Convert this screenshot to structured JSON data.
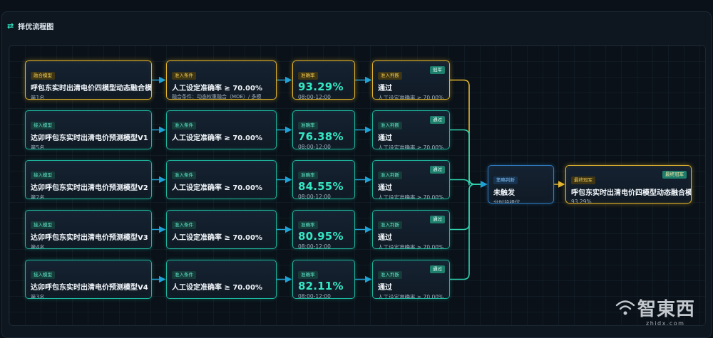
{
  "panel": {
    "title": "择优流程图",
    "icon": "flow-icon"
  },
  "colors": {
    "accent": "#1fb69d",
    "gold": "#e3b52e",
    "blue": "#2f7ec4",
    "link": "#1fa1d6"
  },
  "rows": [
    {
      "model": {
        "tag": "融合模型",
        "name": "呼包东实时出清电价四模型动态融合模型",
        "rank": "第1名",
        "style": "gold"
      },
      "condition": {
        "tag": "准入条件",
        "text": "人工设定准确率 ≥ 70.00%",
        "note": "融合条件：动态权重融合（MOE）/ 多模型... 权融合",
        "style": "gold"
      },
      "accuracy": {
        "tag": "准确率",
        "value": "93.29%",
        "time": "08:00-12:00",
        "style": "gold"
      },
      "judge": {
        "tag": "准入判断",
        "badge": "冠军",
        "result": "通过",
        "detail": "人工设定准确率 ≥ 70.00%",
        "style": "gold"
      }
    },
    {
      "model": {
        "tag": "接入模型",
        "name": "达卯呼包东实时出清电价预测模型V1",
        "rank": "第5名",
        "style": ""
      },
      "condition": {
        "tag": "准入条件",
        "text": "人工设定准确率 ≥ 70.00%",
        "note": "",
        "style": ""
      },
      "accuracy": {
        "tag": "准确率",
        "value": "76.38%",
        "time": "08:00-12:00",
        "style": ""
      },
      "judge": {
        "tag": "准入判断",
        "badge": "通过",
        "result": "通过",
        "detail": "人工设定准确率 ≥ 70.00%",
        "style": ""
      }
    },
    {
      "model": {
        "tag": "接入模型",
        "name": "达卯呼包东实时出清电价预测模型V2",
        "rank": "第2名",
        "style": ""
      },
      "condition": {
        "tag": "准入条件",
        "text": "人工设定准确率 ≥ 70.00%",
        "note": "",
        "style": ""
      },
      "accuracy": {
        "tag": "准确率",
        "value": "84.55%",
        "time": "08:00-12:00",
        "style": ""
      },
      "judge": {
        "tag": "准入判断",
        "badge": "通过",
        "result": "通过",
        "detail": "人工设定准确率 ≥ 70.00%",
        "style": ""
      }
    },
    {
      "model": {
        "tag": "接入模型",
        "name": "达卯呼包东实时出清电价预测模型V3",
        "rank": "第4名",
        "style": ""
      },
      "condition": {
        "tag": "准入条件",
        "text": "人工设定准确率 ≥ 70.00%",
        "note": "",
        "style": ""
      },
      "accuracy": {
        "tag": "准确率",
        "value": "80.95%",
        "time": "08:00-12:00",
        "style": ""
      },
      "judge": {
        "tag": "准入判断",
        "badge": "通过",
        "result": "通过",
        "detail": "人工设定准确率 ≥ 70.00%",
        "style": ""
      }
    },
    {
      "model": {
        "tag": "接入模型",
        "name": "达卯呼包东实时出清电价预测模型V4",
        "rank": "第3名",
        "style": ""
      },
      "condition": {
        "tag": "准入条件",
        "text": "人工设定准确率 ≥ 70.00%",
        "note": "",
        "style": ""
      },
      "accuracy": {
        "tag": "准确率",
        "value": "82.11%",
        "time": "08:00-12:00",
        "style": ""
      },
      "judge": {
        "tag": "准入判断",
        "badge": "通过",
        "result": "通过",
        "detail": "人工设定准确率 ≥ 70.00%",
        "style": ""
      }
    }
  ],
  "strategy": {
    "tag": "策略判断",
    "status": "未触发",
    "desc": "分时段择优"
  },
  "final": {
    "tag": "最终冠军",
    "badge": "最终冠军",
    "name": "呼包东实时出清电价四模型动态融合模型",
    "value": "93.29%"
  },
  "watermark": {
    "text": "智東西",
    "url": "zhidx.com"
  }
}
